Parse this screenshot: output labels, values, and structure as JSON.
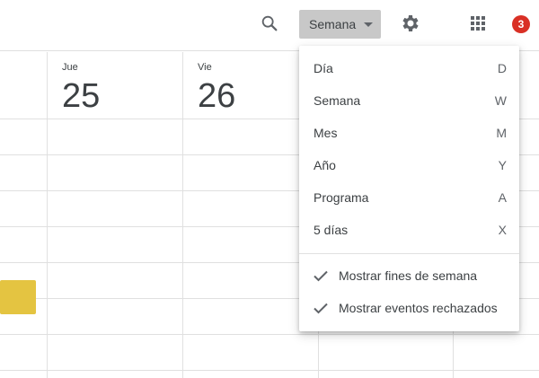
{
  "header": {
    "search_icon": "search-icon",
    "view_select": {
      "selected": "Semana"
    },
    "settings_icon": "gear-icon",
    "apps_icon": "apps-grid-icon",
    "notifications_count": "3",
    "colors": {
      "badge": "#d93025",
      "select_bg": "#c8c8c8"
    }
  },
  "days": [
    {
      "name": "Jue",
      "number": "25"
    },
    {
      "name": "Vie",
      "number": "26"
    }
  ],
  "event": {
    "color": "#e4c441"
  },
  "view_menu": {
    "items": [
      {
        "label": "Día",
        "shortcut": "D"
      },
      {
        "label": "Semana",
        "shortcut": "W"
      },
      {
        "label": "Mes",
        "shortcut": "M"
      },
      {
        "label": "Año",
        "shortcut": "Y"
      },
      {
        "label": "Programa",
        "shortcut": "A"
      },
      {
        "label": "5 días",
        "shortcut": "X"
      }
    ],
    "options": [
      {
        "label": "Mostrar fines de semana",
        "checked": true
      },
      {
        "label": "Mostrar eventos rechazados",
        "checked": true
      }
    ]
  }
}
